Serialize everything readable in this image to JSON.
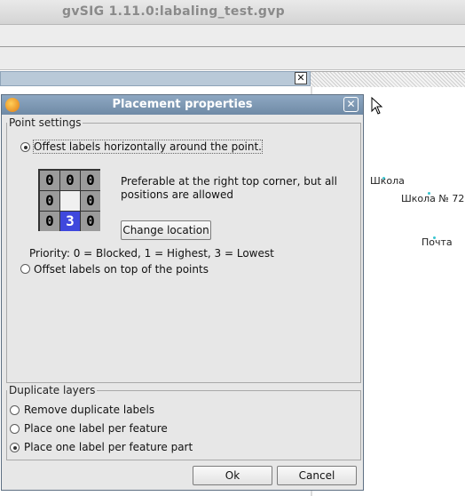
{
  "app": {
    "title": "gvSIG 1.11.0:labaling_test.gvp"
  },
  "map": {
    "labels": [
      {
        "text": "Школа"
      },
      {
        "text": "Школа № 72"
      },
      {
        "text": "Почта"
      }
    ]
  },
  "dialog": {
    "title": "Placement properties",
    "point_settings": {
      "legend": "Point settings",
      "option_around": "Offest labels horizontally around the point.",
      "option_on_top": "Offset labels on top of the points",
      "selected_option": "around",
      "grid": [
        [
          "0",
          "0",
          "0"
        ],
        [
          "0",
          "",
          "0"
        ],
        [
          "0",
          "3",
          "0"
        ]
      ],
      "selected_cell": "bottom-center",
      "description": "Preferable at the right top corner, but all positions are allowed",
      "change_button": "Change location",
      "priority_text": "Priority: 0 = Blocked, 1 = Highest, 3 = Lowest"
    },
    "duplicate_layers": {
      "legend": "Duplicate layers",
      "options": [
        "Remove duplicate labels",
        "Place one label per feature",
        "Place one label per feature part"
      ],
      "selected_index": 2
    },
    "buttons": {
      "ok": "Ok",
      "cancel": "Cancel"
    }
  },
  "colors": {
    "dialog_title_bar": "#7f99b4",
    "selected_cell": "#3f48dd",
    "map_point": "#39c5d0"
  }
}
